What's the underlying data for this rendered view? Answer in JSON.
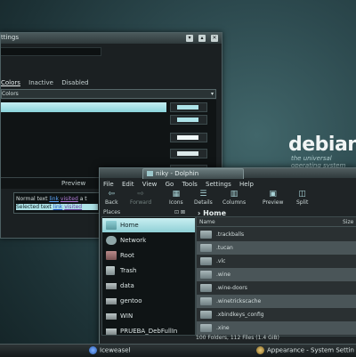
{
  "desktop": {
    "logo_text": "debian",
    "tagline": "the universal operating system"
  },
  "settings_window": {
    "title": "ttings",
    "tabs": [
      "Colors",
      "Inactive",
      "Disabled"
    ],
    "color_set_value": "Colors",
    "preview_label": "Preview",
    "preview": {
      "normal_prefix": "Normal text ",
      "link": "link",
      "visited": "visited",
      "normal_suffix": " a t",
      "selected_prefix": "Selected text ",
      "selected_link": "link",
      "selected_visited": "visited"
    },
    "swatch_colors": [
      "#aee3e8",
      "#aee3e8",
      "#f0f8f8",
      "#dce9ea",
      "#f4ecb8"
    ]
  },
  "dolphin": {
    "title": "niky - Dolphin",
    "menu": [
      "File",
      "Edit",
      "View",
      "Go",
      "Tools",
      "Settings",
      "Help"
    ],
    "toolbar": {
      "back": "Back",
      "forward": "Forward",
      "icons": "Icons",
      "details": "Details",
      "columns": "Columns",
      "preview": "Preview",
      "split": "Split"
    },
    "places_title": "Places",
    "places": [
      "Home",
      "Network",
      "Root",
      "Trash",
      "data",
      "gentoo",
      "WIN",
      "PRUEBA_DebFullIn"
    ],
    "breadcrumb": "Home",
    "columns": {
      "name": "Name",
      "size": "Size"
    },
    "files": [
      ".trackballs",
      ".tucan",
      ".vlc",
      ".wine",
      ".wine-doors",
      ".winetrickscache",
      ".xbindkeys_config",
      ".xine"
    ],
    "status": "100 Folders, 112 Files (1.4 GiB)"
  },
  "taskbar": {
    "items": [
      "Iceweasel",
      "Appearance - System Settin"
    ]
  },
  "colors": {
    "accent": "#aee3e8",
    "link": "#5fa8ff",
    "visited": "#b07ad8"
  }
}
